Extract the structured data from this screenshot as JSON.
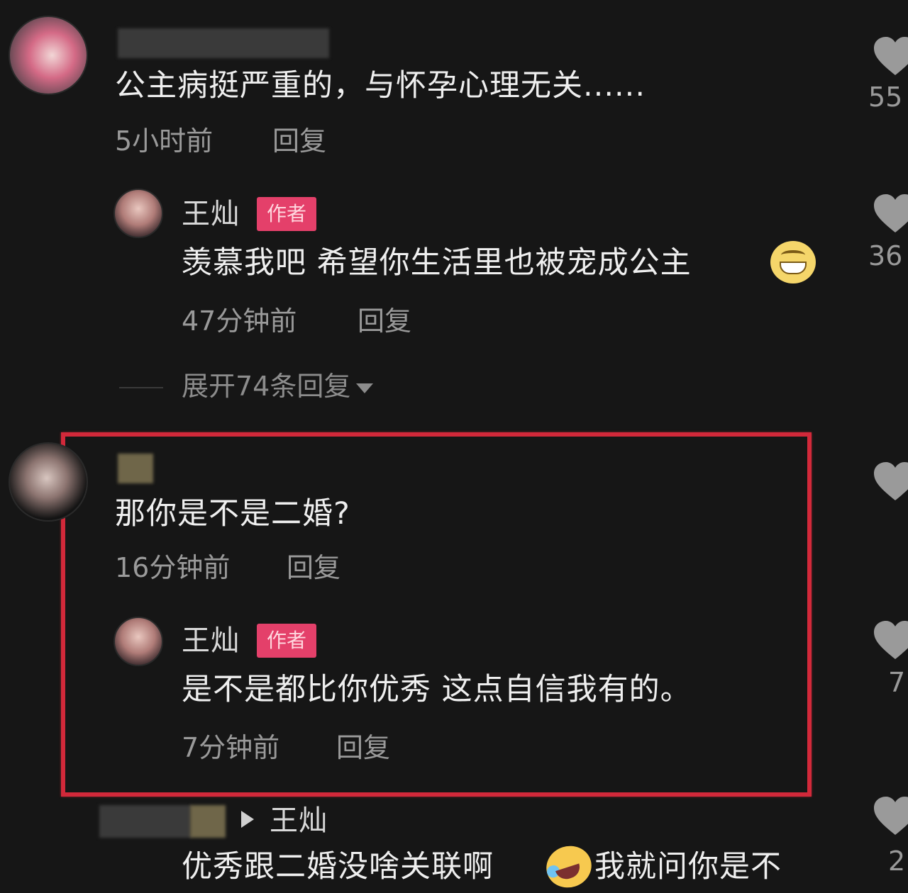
{
  "comments": [
    {
      "text": "公主病挺严重的，与怀孕心理无关......",
      "time": "5小时前",
      "reply_label": "回复",
      "likes": "55",
      "reply": {
        "name": "王灿",
        "badge": "作者",
        "text": "羡慕我吧 希望你生活里也被宠成公主",
        "time": "47分钟前",
        "reply_label": "回复",
        "likes": "36",
        "emoji": "grin-emoji"
      },
      "expand_label": "展开74条回复"
    },
    {
      "text": "那你是不是二婚?",
      "time": "16分钟前",
      "reply_label": "回复",
      "likes": "",
      "reply": {
        "name": "王灿",
        "badge": "作者",
        "text": "是不是都比你优秀 这点自信我有的。",
        "time": "7分钟前",
        "reply_label": "回复",
        "likes": "7"
      }
    },
    {
      "reply_to": "王灿",
      "text_before_emoji": "优秀跟二婚没啥关联啊",
      "text_after_emoji": "我就问你是不",
      "emoji": "laughing-tears-emoji",
      "likes": "2"
    }
  ],
  "colors": {
    "background": "#161616",
    "highlight_border": "#d2293a",
    "author_badge": "#e4406a"
  }
}
